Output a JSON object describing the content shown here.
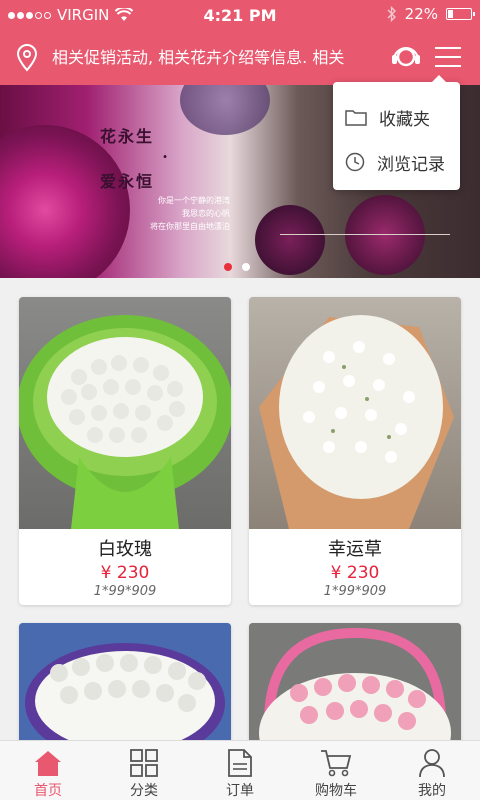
{
  "status_bar": {
    "carrier": "VIRGIN",
    "time": "4:21 PM",
    "battery": "22%",
    "signal_bars": 3
  },
  "header": {
    "marquee": "相关促销活动, 相关花卉介绍等信息. 相关",
    "icons": [
      "location-pin-icon",
      "customer-service-icon",
      "menu-icon"
    ]
  },
  "dropdown": {
    "items": [
      {
        "label": "收藏夹",
        "icon": "folder-icon"
      },
      {
        "label": "浏览记录",
        "icon": "clock-icon"
      }
    ]
  },
  "banner": {
    "line1": "花永生",
    "dot": "·",
    "line2": "爱永恒",
    "poem": [
      "你是一个宁静的港湾",
      "我思恋的心帆",
      "将在你那里自由地漂泊"
    ],
    "slide_count": 2,
    "active_slide": 1
  },
  "products": [
    {
      "name": "白玫瑰",
      "price": "¥ 230",
      "spec": "1*99*909"
    },
    {
      "name": "幸运草",
      "price": "¥ 230",
      "spec": "1*99*909"
    }
  ],
  "tabbar": {
    "items": [
      {
        "label": "首页",
        "icon": "home-icon",
        "active": true
      },
      {
        "label": "分类",
        "icon": "grid-icon",
        "active": false
      },
      {
        "label": "订单",
        "icon": "document-icon",
        "active": false
      },
      {
        "label": "购物车",
        "icon": "cart-icon",
        "active": false
      },
      {
        "label": "我的",
        "icon": "user-icon",
        "active": false
      }
    ]
  },
  "colors": {
    "brand": "#e8586f",
    "price": "#e8213a"
  }
}
